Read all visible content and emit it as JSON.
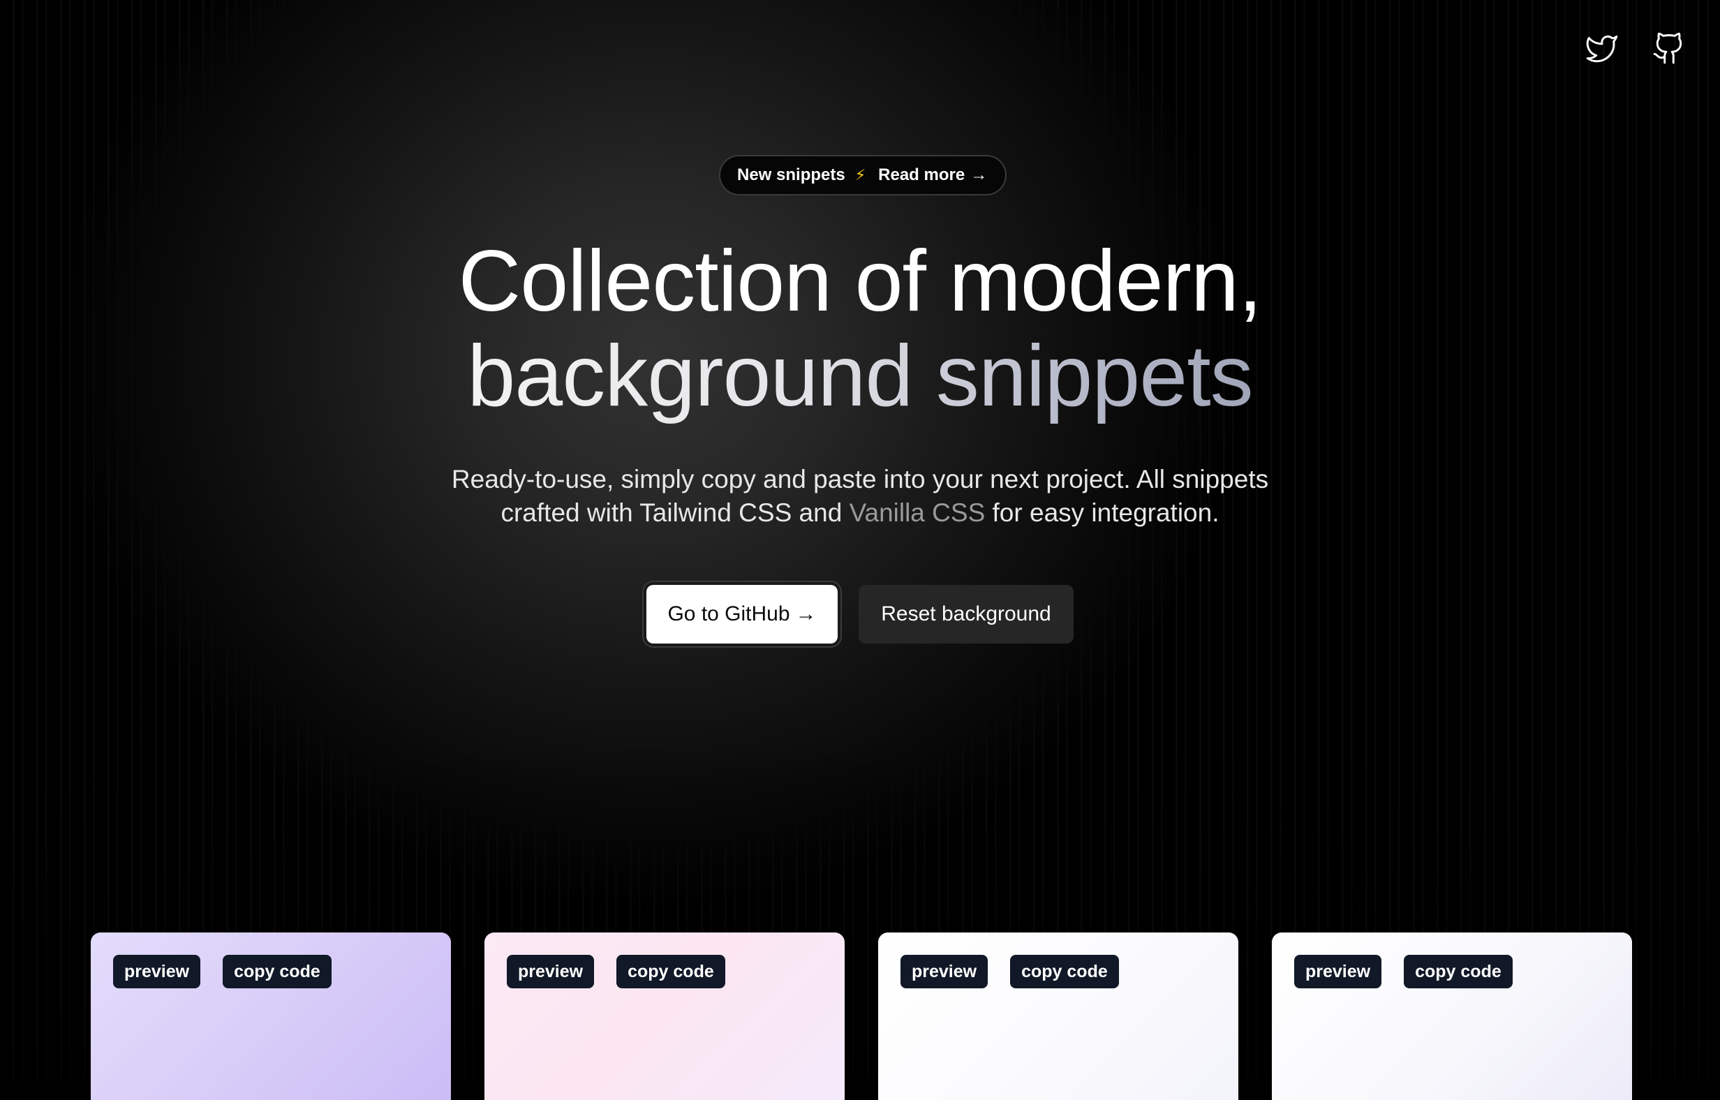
{
  "header": {
    "social": [
      {
        "name": "twitter",
        "icon": "twitter-icon"
      },
      {
        "name": "github",
        "icon": "github-icon"
      }
    ]
  },
  "announcement": {
    "label": "New snippets",
    "emoji": "⚡",
    "link_text": "Read more",
    "arrow": "→"
  },
  "hero": {
    "title_line1": "Collection of modern,",
    "title_line2": "background snippets",
    "subtitle_part1": "Ready-to-use, simply copy and paste into your next project. All snippets crafted with Tailwind CSS and ",
    "subtitle_highlight": "Vanilla CSS",
    "subtitle_part2": " for easy integration."
  },
  "buttons": {
    "primary_label": "Go to GitHub",
    "primary_arrow": "→",
    "secondary_label": "Reset background"
  },
  "cards": [
    {
      "preview_label": "preview",
      "copy_label": "copy code"
    },
    {
      "preview_label": "preview",
      "copy_label": "copy code"
    },
    {
      "preview_label": "preview",
      "copy_label": "copy code"
    },
    {
      "preview_label": "preview",
      "copy_label": "copy code"
    }
  ],
  "colors": {
    "background": "#000000",
    "button_primary_bg": "#ffffff",
    "button_secondary_bg": "#262626",
    "tag_bg": "#111827",
    "bolt": "#facc15"
  }
}
